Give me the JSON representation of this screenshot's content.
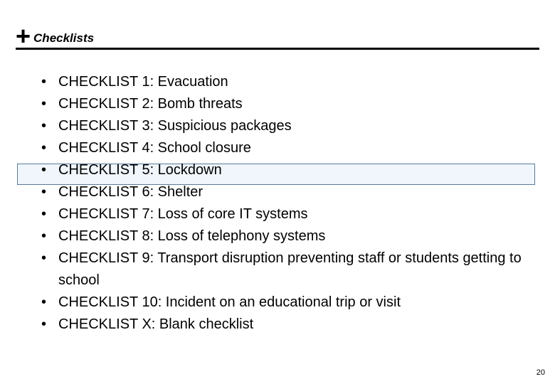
{
  "header": {
    "plus": "+",
    "title": "Checklists"
  },
  "items": [
    "CHECKLIST 1: Evacuation",
    "CHECKLIST 2: Bomb threats",
    "CHECKLIST 3: Suspicious packages",
    "CHECKLIST 4: School closure",
    "CHECKLIST 5: Lockdown",
    "CHECKLIST 6: Shelter",
    "CHECKLIST 7: Loss of core IT systems",
    "CHECKLIST 8: Loss of telephony systems",
    "CHECKLIST 9: Transport disruption preventing staff or students getting to school",
    "CHECKLIST 10: Incident on an educational trip or visit",
    "CHECKLIST X: Blank checklist"
  ],
  "page_number": "20"
}
